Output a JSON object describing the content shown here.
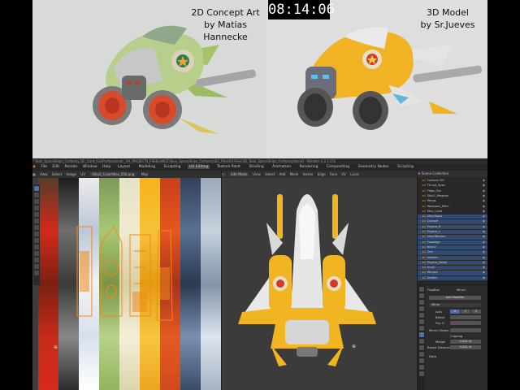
{
  "timer": "08:14:06",
  "credits": {
    "left_line1": "2D Concept Art",
    "left_line2": "by Matias Hannecke",
    "right_line1": "3D Model",
    "right_line2": "by Sr.Jueves"
  },
  "blender": {
    "title_text": "* Toon_SpaceShips_Cartoony [D:_Cont_ConProfessional\\ _AA_PROJECTS_FREELANCE\\Toon_SpaceShips_Cartoony\\02_Files\\03 Files\\3D_Toon_SpaceShips_Cartoony.blend] - Blender 4.2.1 LTS",
    "menu": [
      "File",
      "Edit",
      "Render",
      "Window",
      "Help"
    ],
    "workspaces": [
      "Layout",
      "Modeling",
      "Sculpting",
      "UV Editing",
      "Texture Paint",
      "Shading",
      "Animation",
      "Rendering",
      "Compositing",
      "Geometry Nodes",
      "Scripting"
    ],
    "active_workspace": "UV Editing",
    "uv_header": [
      "View",
      "Select",
      "Image",
      "UV"
    ],
    "uv_image_name": "Ship2_ColorAtlas_256.png",
    "uv_mode": "Map",
    "viewport_header": [
      "Edit Mode",
      "View",
      "Select",
      "Add",
      "Mesh",
      "Vertex",
      "Edge",
      "Face",
      "UV"
    ],
    "viewport_orientation": "Local",
    "outliner_title": "Scene Collection",
    "outliner_rows": [
      {
        "name": "Cockpit.001",
        "selected": false
      },
      {
        "name": "Thrust_Spec",
        "selected": false
      },
      {
        "name": "Flaps_Sec",
        "selected": false
      },
      {
        "name": "Ship2_Weapon",
        "selected": false
      },
      {
        "name": "Wings",
        "selected": false
      },
      {
        "name": "Weapons_Mirrr",
        "selected": false
      },
      {
        "name": "Ship_Light",
        "selected": false
      },
      {
        "name": "Ship2Spec",
        "selected": true
      },
      {
        "name": "Cockpit",
        "selected": true
      },
      {
        "name": "Engine_R",
        "selected": true
      },
      {
        "name": "Engine_L",
        "selected": true
      },
      {
        "name": "Ship2Bodies",
        "selected": true
      },
      {
        "name": "Fuselage",
        "selected": true
      },
      {
        "name": "Nose2",
        "selected": true
      },
      {
        "name": "Fins",
        "selected": true
      },
      {
        "name": "Intakes",
        "selected": true
      },
      {
        "name": "Engine_Detail",
        "selected": true
      },
      {
        "name": "Gun2",
        "selected": true
      },
      {
        "name": "Wings2",
        "selected": true
      },
      {
        "name": "Details",
        "selected": true
      }
    ],
    "properties": {
      "object_name": "FlapBox",
      "modifier_tab": "Mirror",
      "add_modifier": "Add Modifier",
      "modifier_name": "Mirror",
      "axis_label": "Axis",
      "bisect_label": "Bisect",
      "flip_label": "Flip U",
      "axis_values": [
        "X",
        "Y",
        "Z"
      ],
      "mirror_object_label": "Mirror Object",
      "clipping_label": "Clipping",
      "merge_label": "Merge",
      "merge_value": "0.001 m",
      "bisect_dist_label": "Bisect Distance",
      "bisect_dist_value": "0.001 m",
      "data_label": "Data"
    },
    "colors": {
      "accent": "#4772b3"
    }
  }
}
